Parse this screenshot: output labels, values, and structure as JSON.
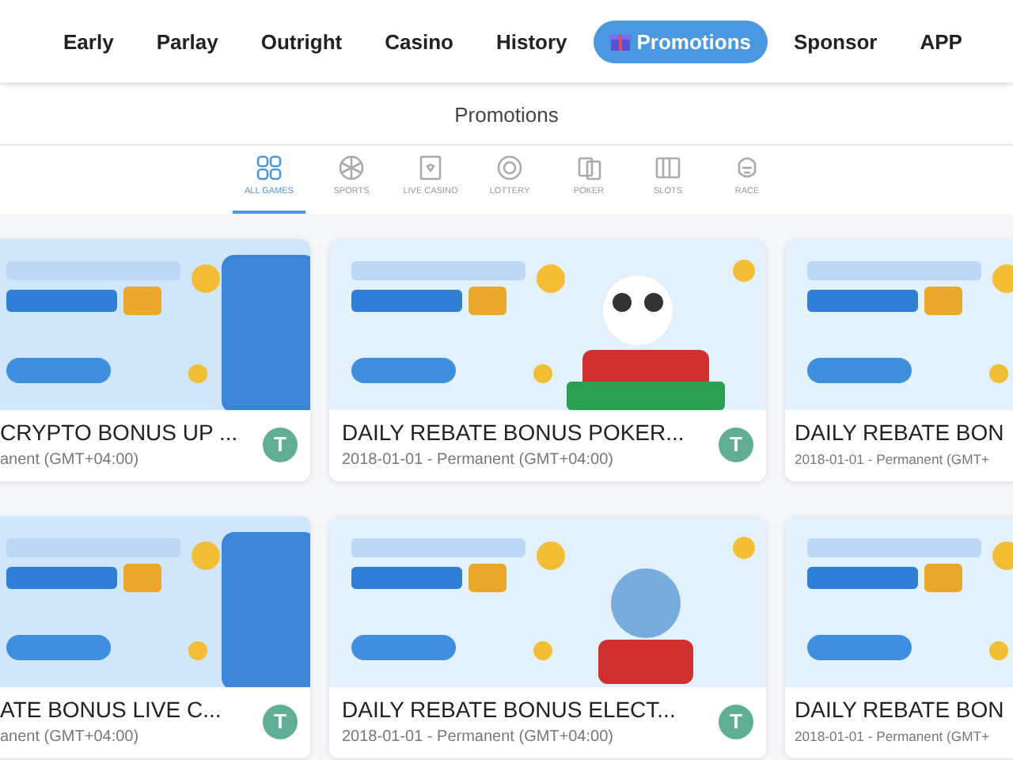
{
  "nav": [
    {
      "label": "Early",
      "selected": false
    },
    {
      "label": "Parlay",
      "selected": false
    },
    {
      "label": "Outright",
      "selected": false
    },
    {
      "label": "Casino",
      "selected": false
    },
    {
      "label": "History",
      "selected": false
    },
    {
      "label": "Promotions",
      "selected": true
    },
    {
      "label": "Sponsor",
      "selected": false
    },
    {
      "label": "APP",
      "selected": false
    }
  ],
  "page_title": "Promotions",
  "categories": [
    {
      "label": "ALL GAMES",
      "kind": "grid",
      "selected": true
    },
    {
      "label": "SPORTS",
      "kind": "ball",
      "selected": false
    },
    {
      "label": "LIVE CASINO",
      "kind": "card",
      "selected": false
    },
    {
      "label": "LOTTERY",
      "kind": "coin",
      "selected": false
    },
    {
      "label": "POKER",
      "kind": "cards",
      "selected": false
    },
    {
      "label": "SLOTS",
      "kind": "slot",
      "selected": false
    },
    {
      "label": "RACE",
      "kind": "head",
      "selected": false
    }
  ],
  "promotions": [
    {
      "title": "CRYPTO BONUS UP ...",
      "period": "anent (GMT+04:00)",
      "badge": "T"
    },
    {
      "title": "DAILY REBATE BONUS POKER...",
      "period": "2018-01-01 - Permanent (GMT+04:00)",
      "badge": "T"
    },
    {
      "title": "DAILY REBATE BON",
      "period": "2018-01-01 - Permanent (GMT+"
    },
    {
      "title": "ATE BONUS LIVE C...",
      "period": "anent (GMT+04:00)",
      "badge": "T"
    },
    {
      "title": "DAILY REBATE BONUS ELECT...",
      "period": "2018-01-01 - Permanent (GMT+04:00)",
      "badge": "T"
    },
    {
      "title": "DAILY REBATE BON",
      "period": "2018-01-01 - Permanent (GMT+"
    }
  ]
}
